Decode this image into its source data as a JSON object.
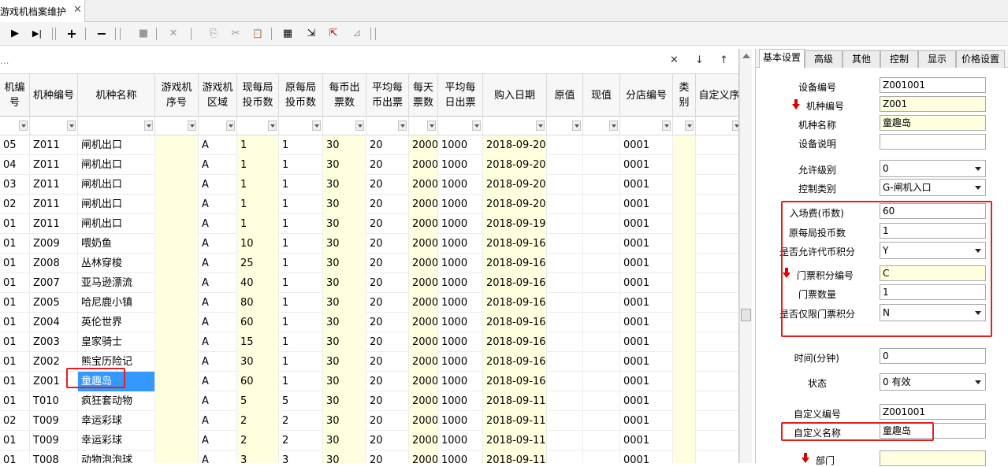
{
  "tab": {
    "title": "游戏机档案维护",
    "close": "✕"
  },
  "toolbar": {
    "play": "▶",
    "last": "▶|",
    "add": "+",
    "remove": "−",
    "stop": "■",
    "cancel": "✕",
    "copy": "⎘",
    "cut": "✂",
    "paste": "📋",
    "props": "▦",
    "export": "⇲",
    "import": "⇱",
    "chart": "⊿"
  },
  "search": {
    "ellipsis": "...",
    "clear": "✕",
    "down": "↓",
    "up": "↑"
  },
  "grid": {
    "headers": [
      "机编号",
      "机种编号",
      "机种名称",
      "游戏机\n序号",
      "游戏机\n区域",
      "现每局\n投币数",
      "原每局\n投币数",
      "每币出\n票数",
      "平均每\n币出票",
      "每天\n票数",
      "平均每\n日出票",
      "购入日期",
      "原值",
      "现值",
      "分店编号",
      "类\n别",
      "自定义序"
    ],
    "rows": [
      [
        "05",
        "Z011",
        "闸机出口",
        "",
        "A",
        "1",
        "1",
        "30",
        "20",
        "2000",
        "1000",
        "2018-09-20",
        "",
        "",
        "0001",
        "",
        ""
      ],
      [
        "04",
        "Z011",
        "闸机出口",
        "",
        "A",
        "1",
        "1",
        "30",
        "20",
        "2000",
        "1000",
        "2018-09-20",
        "",
        "",
        "0001",
        "",
        ""
      ],
      [
        "03",
        "Z011",
        "闸机出口",
        "",
        "A",
        "1",
        "1",
        "30",
        "20",
        "2000",
        "1000",
        "2018-09-20",
        "",
        "",
        "0001",
        "",
        ""
      ],
      [
        "02",
        "Z011",
        "闸机出口",
        "",
        "A",
        "1",
        "1",
        "30",
        "20",
        "2000",
        "1000",
        "2018-09-20",
        "",
        "",
        "0001",
        "",
        ""
      ],
      [
        "01",
        "Z011",
        "闸机出口",
        "",
        "A",
        "1",
        "1",
        "30",
        "20",
        "2000",
        "1000",
        "2018-09-19",
        "",
        "",
        "0001",
        "",
        ""
      ],
      [
        "01",
        "Z009",
        "喂奶鱼",
        "",
        "A",
        "10",
        "1",
        "30",
        "20",
        "2000",
        "1000",
        "2018-09-16",
        "",
        "",
        "0001",
        "",
        ""
      ],
      [
        "01",
        "Z008",
        "丛林穿梭",
        "",
        "A",
        "25",
        "1",
        "30",
        "20",
        "2000",
        "1000",
        "2018-09-16",
        "",
        "",
        "0001",
        "",
        ""
      ],
      [
        "01",
        "Z007",
        "亚马逊漂流",
        "",
        "A",
        "40",
        "1",
        "30",
        "20",
        "2000",
        "1000",
        "2018-09-16",
        "",
        "",
        "0001",
        "",
        ""
      ],
      [
        "01",
        "Z005",
        "哈尼鹿小镇",
        "",
        "A",
        "80",
        "1",
        "30",
        "20",
        "2000",
        "1000",
        "2018-09-16",
        "",
        "",
        "0001",
        "",
        ""
      ],
      [
        "01",
        "Z004",
        "英伦世界",
        "",
        "A",
        "60",
        "1",
        "30",
        "20",
        "2000",
        "1000",
        "2018-09-16",
        "",
        "",
        "0001",
        "",
        ""
      ],
      [
        "01",
        "Z003",
        "皇家骑士",
        "",
        "A",
        "15",
        "1",
        "30",
        "20",
        "2000",
        "1000",
        "2018-09-16",
        "",
        "",
        "0001",
        "",
        ""
      ],
      [
        "01",
        "Z002",
        "熊宝历险记",
        "",
        "A",
        "30",
        "1",
        "30",
        "20",
        "2000",
        "1000",
        "2018-09-16",
        "",
        "",
        "0001",
        "",
        ""
      ],
      [
        "01",
        "Z001",
        "童趣岛",
        "",
        "A",
        "60",
        "1",
        "30",
        "20",
        "2000",
        "1000",
        "2018-09-16",
        "",
        "",
        "0001",
        "",
        ""
      ],
      [
        "01",
        "T010",
        "疯狂套动物",
        "",
        "A",
        "5",
        "5",
        "30",
        "20",
        "2000",
        "1000",
        "2018-09-11",
        "",
        "",
        "0001",
        "",
        ""
      ],
      [
        "02",
        "T009",
        "幸运彩球",
        "",
        "A",
        "2",
        "2",
        "30",
        "20",
        "2000",
        "1000",
        "2018-09-11",
        "",
        "",
        "0001",
        "",
        ""
      ],
      [
        "01",
        "T009",
        "幸运彩球",
        "",
        "A",
        "2",
        "2",
        "30",
        "20",
        "2000",
        "1000",
        "2018-09-11",
        "",
        "",
        "0001",
        "",
        ""
      ],
      [
        "01",
        "T008",
        "动物泡泡球",
        "",
        "A",
        "3",
        "3",
        "30",
        "20",
        "2000",
        "1000",
        "2018-09-11",
        "",
        "",
        "0001",
        "",
        ""
      ]
    ]
  },
  "panel": {
    "tabs": [
      "基本设置",
      "高级",
      "其他",
      "控制",
      "显示",
      "价格设置"
    ],
    "fields": {
      "device_no_label": "设备编号",
      "device_no": "Z001001",
      "model_no_label": "机种编号",
      "model_no": "Z001",
      "model_name_label": "机种名称",
      "model_name": "童趣岛",
      "device_desc_label": "设备说明",
      "device_desc": "",
      "allow_level_label": "允许级别",
      "allow_level": "0",
      "control_type_label": "控制类别",
      "control_type": "G-闸机入口",
      "entry_fee_label": "入场费(币数)",
      "entry_fee": "60",
      "orig_coins_label": "原每局投币数",
      "orig_coins": "1",
      "allow_token_label": "是否允许代币积分",
      "allow_token": "Y",
      "ticket_code_label": "门票积分编号",
      "ticket_code": "C",
      "ticket_qty_label": "门票数量",
      "ticket_qty": "1",
      "ticket_only_label": "是否仅限门票积分",
      "ticket_only": "N",
      "time_label": "时间(分钟)",
      "time": "0",
      "status_label": "状态",
      "status": "0  有效",
      "custom_no_label": "自定义编号",
      "custom_no": "Z001001",
      "custom_name_label": "自定义名称",
      "custom_name": "童趣岛",
      "dept_label": "部门",
      "dept": ""
    }
  },
  "colors": {
    "highlight": "#e02020",
    "selected": "#3399ff",
    "readonly_yellow": "#ffffe0"
  }
}
